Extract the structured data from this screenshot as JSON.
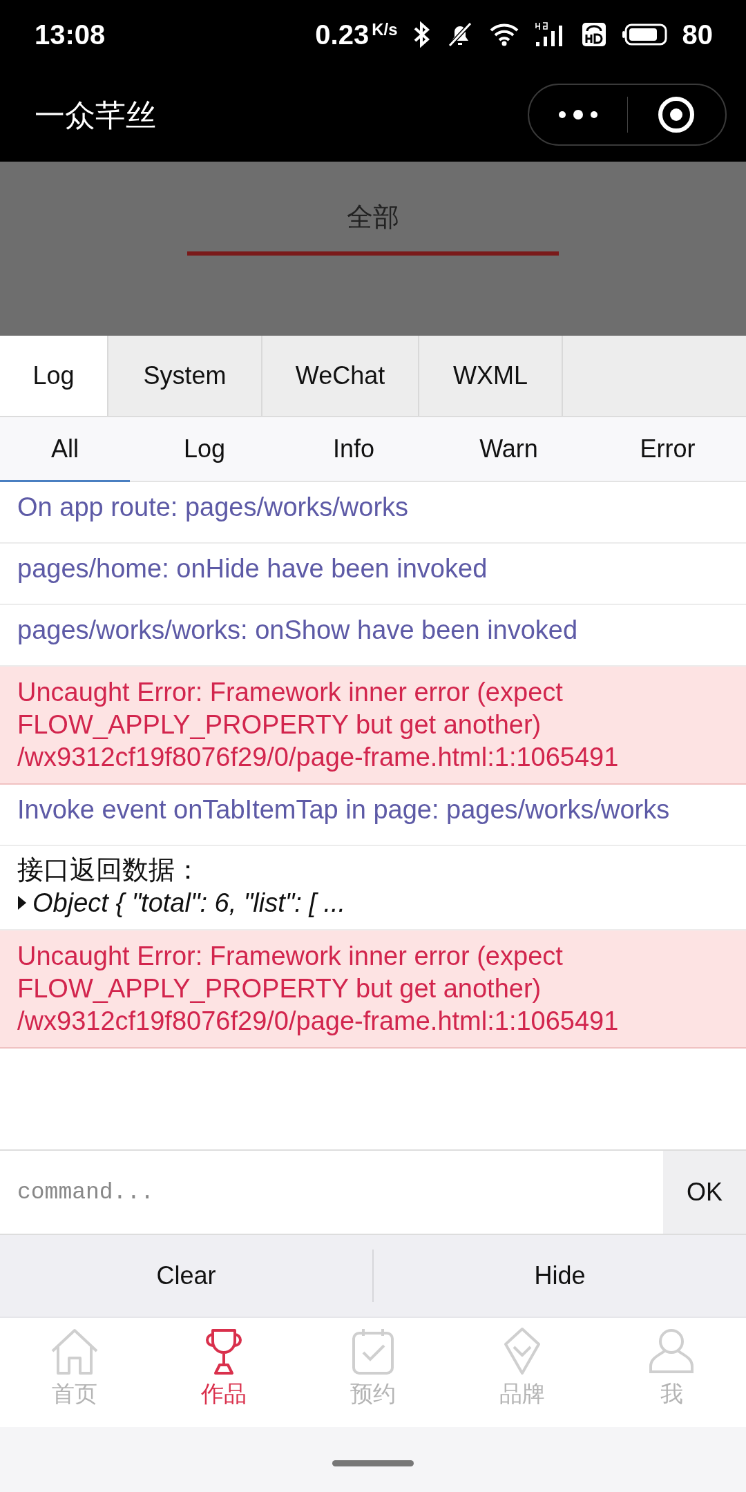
{
  "status_bar": {
    "time": "13:08",
    "net_speed": "0.23",
    "net_unit": "K/s",
    "battery": "80"
  },
  "title_bar": {
    "title": "一众芊丝"
  },
  "page_tabs": [
    {
      "label": "全部",
      "selected": true
    }
  ],
  "console": {
    "tabs": [
      {
        "label": "Log",
        "selected": true
      },
      {
        "label": "System",
        "selected": false
      },
      {
        "label": "WeChat",
        "selected": false
      },
      {
        "label": "WXML",
        "selected": false
      }
    ],
    "filters": [
      {
        "label": "All",
        "selected": true
      },
      {
        "label": "Log",
        "selected": false
      },
      {
        "label": "Info",
        "selected": false
      },
      {
        "label": "Warn",
        "selected": false
      },
      {
        "label": "Error",
        "selected": false
      }
    ],
    "logs": [
      {
        "kind": "info",
        "text": "On app route: pages/works/works"
      },
      {
        "kind": "info",
        "text": "pages/home: onHide have been invoked"
      },
      {
        "kind": "info",
        "text": "pages/works/works: onShow have been invoked"
      },
      {
        "kind": "error",
        "text": "Uncaught Error: Framework inner error (expect\nFLOW_APPLY_PROPERTY but get another)\n/wx9312cf19f8076f29/0/page-frame.html:1:1065491"
      },
      {
        "kind": "info",
        "text": "Invoke event onTabItemTap in page: pages/works/works"
      },
      {
        "kind": "object",
        "label": "接口返回数据：",
        "text": "Object { \"total\": 6, \"list\": [ ..."
      },
      {
        "kind": "error",
        "text": "Uncaught Error: Framework inner error (expect\nFLOW_APPLY_PROPERTY but get another)\n/wx9312cf19f8076f29/0/page-frame.html:1:1065491"
      }
    ],
    "command": {
      "placeholder": "command..."
    },
    "ok": "OK",
    "actions": [
      "Clear",
      "Hide"
    ]
  },
  "tab_bar": [
    {
      "label": "首页",
      "selected": false
    },
    {
      "label": "作品",
      "selected": true
    },
    {
      "label": "预约",
      "selected": false
    },
    {
      "label": "品牌",
      "selected": false
    },
    {
      "label": "我",
      "selected": false
    }
  ]
}
